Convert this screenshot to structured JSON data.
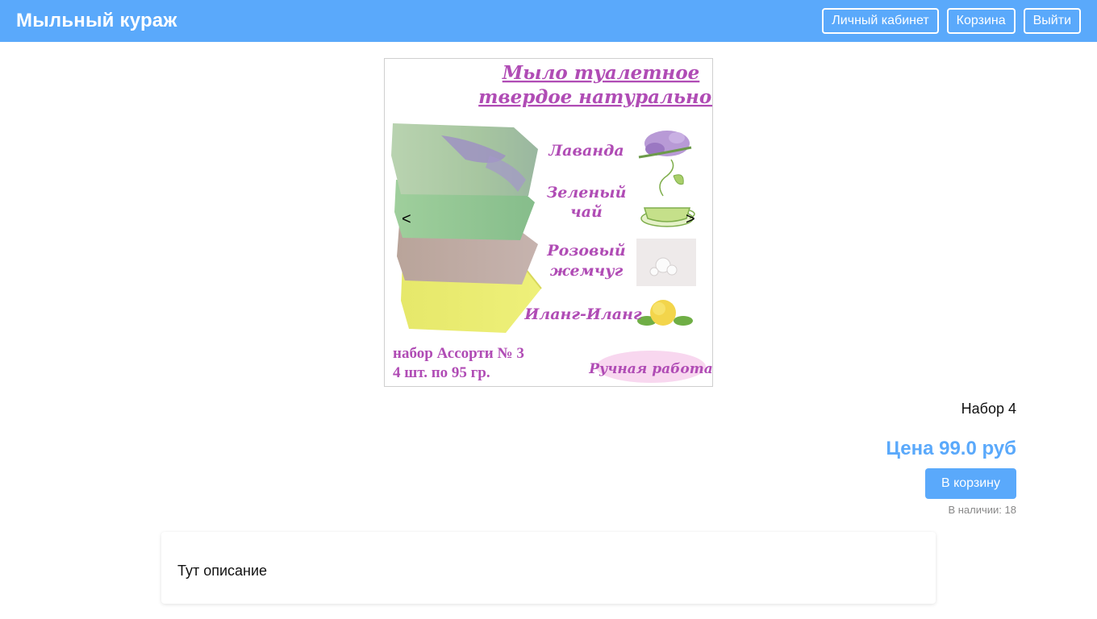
{
  "header": {
    "brand": "Мыльный кураж",
    "nav": {
      "account": "Личный кабинет",
      "cart": "Корзина",
      "logout": "Выйти"
    }
  },
  "gallery": {
    "prev": "<",
    "next": ">",
    "image": {
      "title_line1": "Мыло туалетное",
      "title_line2": "твердое натуральное",
      "flavors": {
        "lavender": "Лаванда",
        "green_tea_1": "Зеленый",
        "green_tea_2": "чай",
        "pearl_1": "Розовый",
        "pearl_2": "жемчуг",
        "ylang": "Иланг-Иланг"
      },
      "set_line1": "набор Ассорти № 3",
      "set_line2": "4 шт. по 95 гр.",
      "handmade": "Ручная работа"
    }
  },
  "product": {
    "name": "Набор 4",
    "price": "Цена 99.0 руб",
    "add_to_cart": "В корзину",
    "stock": "В наличии: 18",
    "description": "Тут описание"
  },
  "colors": {
    "accent": "#5aa9fb",
    "image_text": "#b04cb5"
  }
}
